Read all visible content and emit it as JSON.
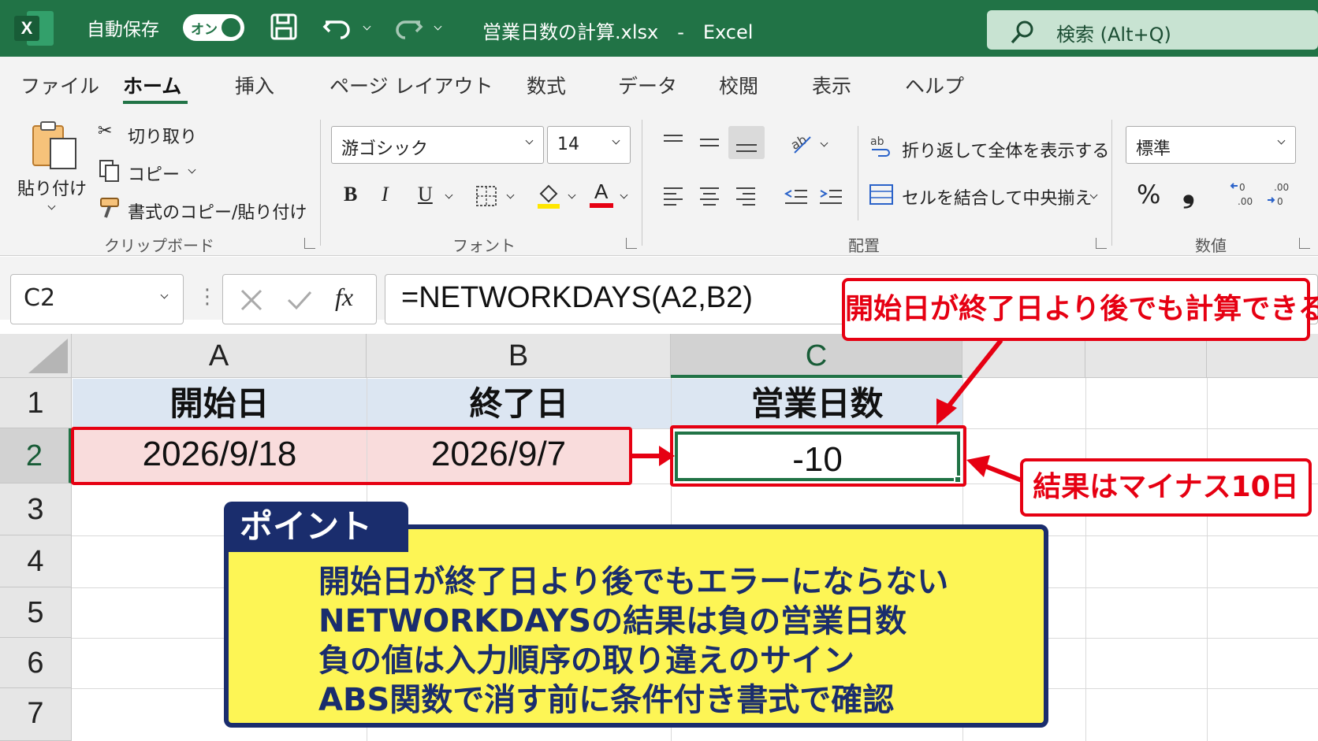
{
  "titlebar": {
    "autosave_label": "自動保存",
    "toggle_label": "オン",
    "doc_title": "営業日数の計算.xlsx　-　Excel",
    "search_placeholder": "検索 (Alt+Q)",
    "logo_letter": "X"
  },
  "tabs": [
    "ファイル",
    "ホーム",
    "挿入",
    "ページ レイアウト",
    "数式",
    "データ",
    "校閲",
    "表示",
    "ヘルプ"
  ],
  "active_tab": "ホーム",
  "ribbon": {
    "clipboard": {
      "paste": "貼り付け",
      "cut": "切り取り",
      "copy": "コピー",
      "format_painter": "書式のコピー/貼り付け",
      "group_label": "クリップボード"
    },
    "font": {
      "font_name": "游ゴシック",
      "font_size": "14",
      "bold": "B",
      "italic": "I",
      "underline": "U",
      "font_color_glyph": "A",
      "group_label": "フォント"
    },
    "alignment": {
      "wrap_text": "折り返して全体を表示する",
      "merge_center": "セルを結合して中央揃え",
      "group_label": "配置"
    },
    "number": {
      "format": "標準",
      "percent": "%",
      "comma": "❟",
      "group_label": "数値"
    }
  },
  "formula_bar": {
    "name_box": "C2",
    "fx": "fx",
    "formula": "=NETWORKDAYS(A2,B2)"
  },
  "sheet": {
    "columns": [
      "A",
      "B",
      "C"
    ],
    "rows": [
      "1",
      "2",
      "3",
      "4",
      "5",
      "6",
      "7"
    ],
    "header_row": [
      "開始日",
      "終了日",
      "営業日数"
    ],
    "data_row": [
      "2026/9/18",
      "2026/9/7",
      "-10"
    ]
  },
  "annotations": {
    "callout_top": "開始日が終了日より後でも計算できる",
    "callout_right": "結果はマイナス10日",
    "point_title": "ポイント",
    "point_lines": [
      "開始日が終了日より後でもエラーにならない",
      "NETWORKDAYSの結果は負の営業日数",
      "負の値は入力順序の取り違えのサイン",
      "ABS関数で消す前に条件付き書式で確認"
    ]
  },
  "colors": {
    "excel_green": "#217346",
    "annotation_red": "#e60012",
    "panel_yellow": "#fdf555",
    "panel_navy": "#1a2d6d",
    "header_fill": "#dce6f2",
    "input_fill": "#f9dcdc"
  }
}
